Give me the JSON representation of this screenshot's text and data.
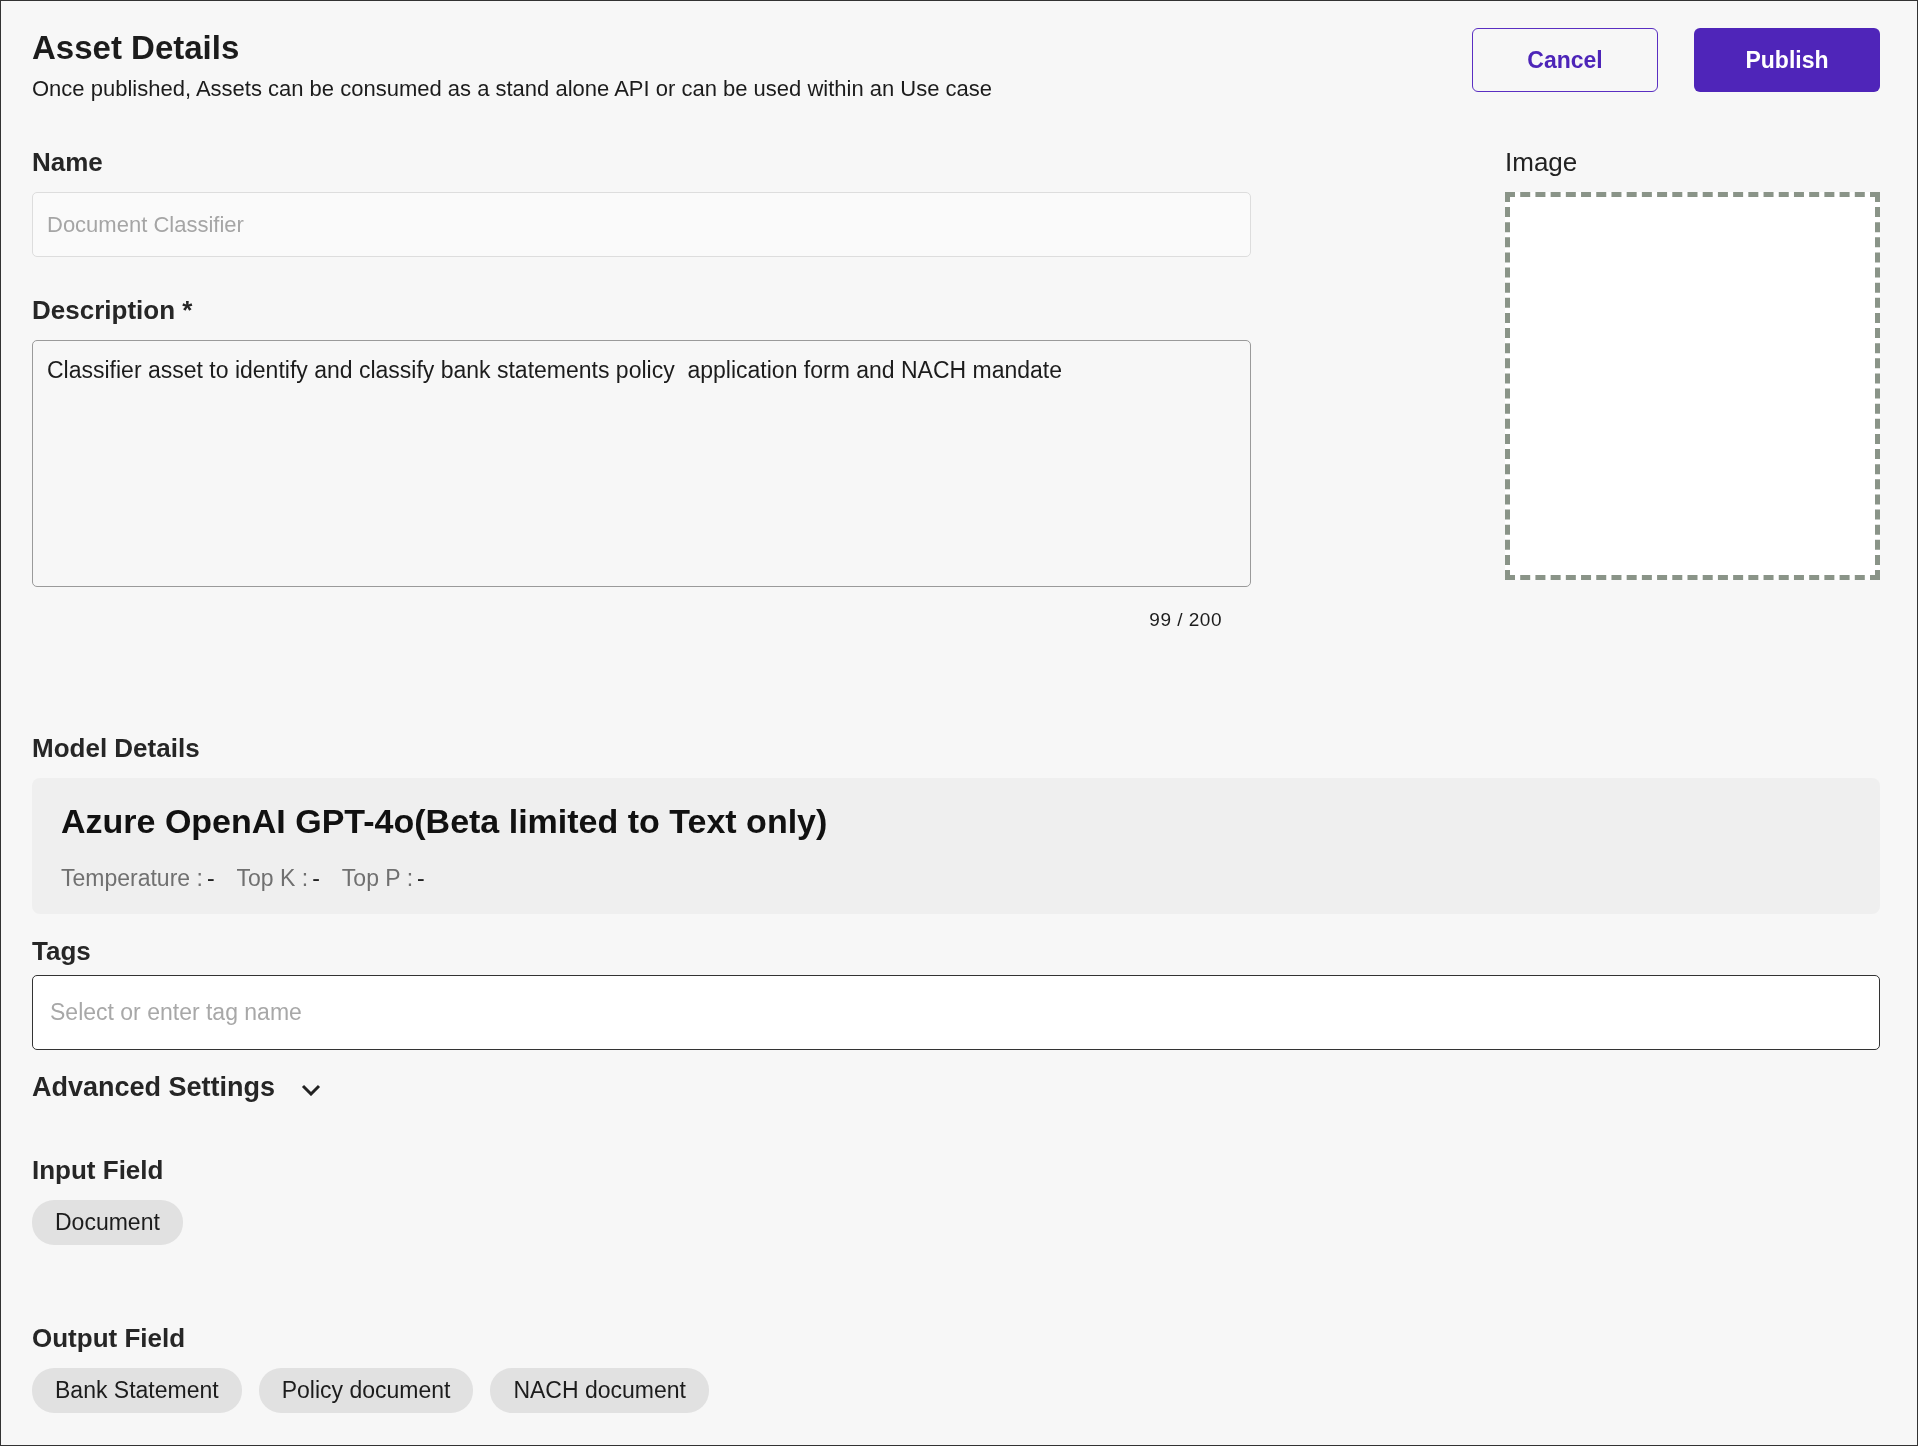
{
  "header": {
    "title": "Asset Details",
    "subtitle": "Once published, Assets can be consumed as a stand alone API or can be used within an Use case"
  },
  "buttons": [
    {
      "label": "Cancel",
      "kind": "secondary"
    },
    {
      "label": "Publish",
      "kind": "primary"
    }
  ],
  "name": {
    "label": "Name",
    "placeholder": "Document Classifier"
  },
  "description": {
    "label": "Description *",
    "value": "Classifier asset to identify and classify bank statements policy  application form and NACH mandate",
    "counter": "99 / 200"
  },
  "image": {
    "label": "Image"
  },
  "model_details": {
    "label": "Model Details",
    "model": "Azure OpenAI GPT-4o(Beta limited to Text only)",
    "params": [
      {
        "label": "Temperature :",
        "value": "-"
      },
      {
        "label": "Top K :",
        "value": "-"
      },
      {
        "label": "Top P :",
        "value": "-"
      }
    ]
  },
  "tags": {
    "label": "Tags",
    "placeholder": "Select or enter tag name"
  },
  "advanced_settings": {
    "label": "Advanced Settings",
    "expanded": false
  },
  "input_field": {
    "label": "Input Field",
    "chips": [
      "Document"
    ]
  },
  "output_field": {
    "label": "Output Field",
    "chips": [
      "Bank Statement",
      "Policy document",
      "NACH document"
    ]
  }
}
